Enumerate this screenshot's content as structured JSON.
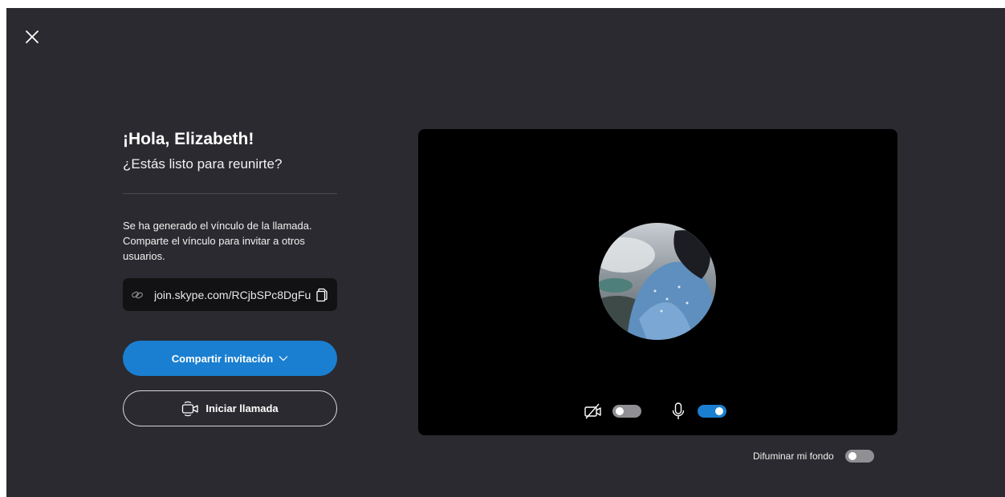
{
  "window": {
    "close_icon": "close-icon"
  },
  "greeting": {
    "title": "¡Hola, Elizabeth!",
    "subtitle": "¿Estás listo para reunirte?"
  },
  "invite": {
    "info_text": "Se ha generado el vínculo de la llamada. Comparte el vínculo para invitar a otros usuarios.",
    "link": "join.skype.com/RCjbSPc8DgFu",
    "link_icon": "link-icon",
    "copy_icon": "copy-icon",
    "share_label": "Compartir invitación",
    "share_icon": "chevron-down-icon",
    "call_label": "Iniciar llamada",
    "call_icon": "video-camera-icon"
  },
  "preview": {
    "avatar": "user-avatar",
    "camera_icon": "camera-off-icon",
    "camera_on": false,
    "mic_icon": "microphone-icon",
    "mic_on": true
  },
  "background": {
    "blur_label": "Difuminar mi fondo",
    "blur_on": false
  },
  "colors": {
    "background": "#2a2a30",
    "accent": "#1a7fd1",
    "preview_bg": "#000000"
  }
}
